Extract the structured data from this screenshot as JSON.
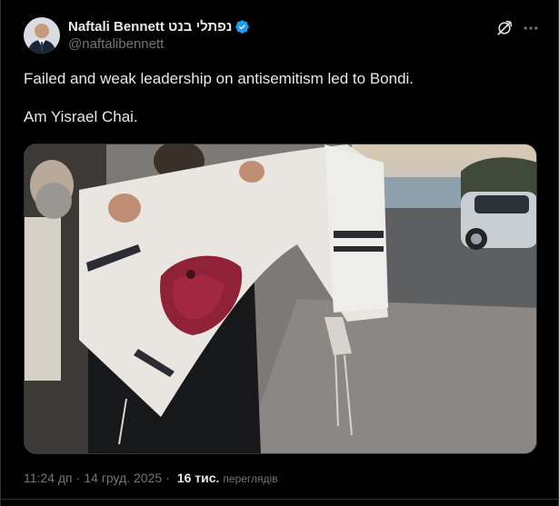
{
  "author": {
    "display_name": "Naftali Bennett נפתלי בנט",
    "handle": "@naftalibennett",
    "verified": true,
    "verified_color": "#1d9bf0"
  },
  "header_actions": {
    "grok_icon": "grok-icon",
    "more_icon": "more-horizontal-icon"
  },
  "tweet": {
    "lines": [
      "Failed and weak leadership on antisemitism led to Bondi.",
      "Am Yisrael Chai."
    ]
  },
  "media": {
    "kind": "photo"
  },
  "meta": {
    "time": "11:24 дп",
    "separator": "·",
    "date": "14 груд. 2025",
    "views_count": "16 тис.",
    "views_label": "переглядів"
  },
  "colors": {
    "background": "#000000",
    "text_primary": "#e7e9ea",
    "text_secondary": "#71767b",
    "border": "#2f3336",
    "accent": "#1d9bf0"
  }
}
